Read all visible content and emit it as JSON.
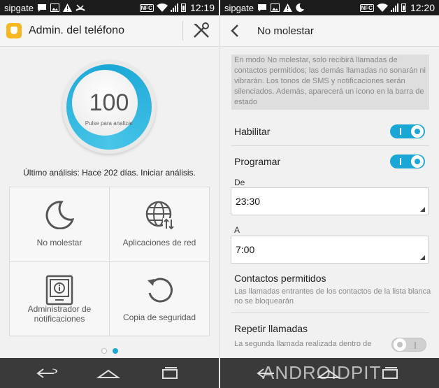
{
  "status_left": {
    "carrier": "sipgate",
    "time": "12:19"
  },
  "status_right": {
    "carrier": "sipgate",
    "time": "12:20"
  },
  "status_nfc": "NFC",
  "left_screen": {
    "title": "Admin. del teléfono",
    "score": "100",
    "score_hint": "Pulse para analizar",
    "last_scan": "Último análisis: Hace 202 días. Iniciar análisis.",
    "tiles": [
      {
        "label": "No molestar",
        "icon": "moon-icon"
      },
      {
        "label": "Aplicaciones de red",
        "icon": "globe-icon"
      },
      {
        "label": "Administrador de notificaciones",
        "icon": "notification-tablet-icon"
      },
      {
        "label": "Copia de seguridad",
        "icon": "refresh-icon"
      }
    ],
    "page_indicator": {
      "pages": 2,
      "active": 2
    }
  },
  "right_screen": {
    "title": "No molestar",
    "info": "En modo No molestar, solo recibirá llamadas de contactos permitidos; las demás llamadas no sonarán ni vibrarán. Los tonos de SMS y notificaciones serán silenciados. Además, aparecerá un icono en la barra de estado",
    "enable": {
      "label": "Habilitar",
      "on": true
    },
    "schedule": {
      "label": "Programar",
      "on": true
    },
    "from": {
      "label": "De",
      "value": "23:30"
    },
    "to": {
      "label": "A",
      "value": "7:00"
    },
    "allowed_contacts": {
      "title": "Contactos permitidos",
      "desc": "Las llamadas entrantes de los contactos de la lista blanca no se bloquearán"
    },
    "repeat_calls": {
      "title": "Repetir llamadas",
      "desc": "La segunda llamada realizada dentro de",
      "on": false
    }
  },
  "watermark": "ANDROIDPIT",
  "colors": {
    "accent": "#1aa7d6",
    "status_bar": "#1c1c1c",
    "nav_bar": "#3a3a3a",
    "app_icon": "#f6b81e"
  }
}
